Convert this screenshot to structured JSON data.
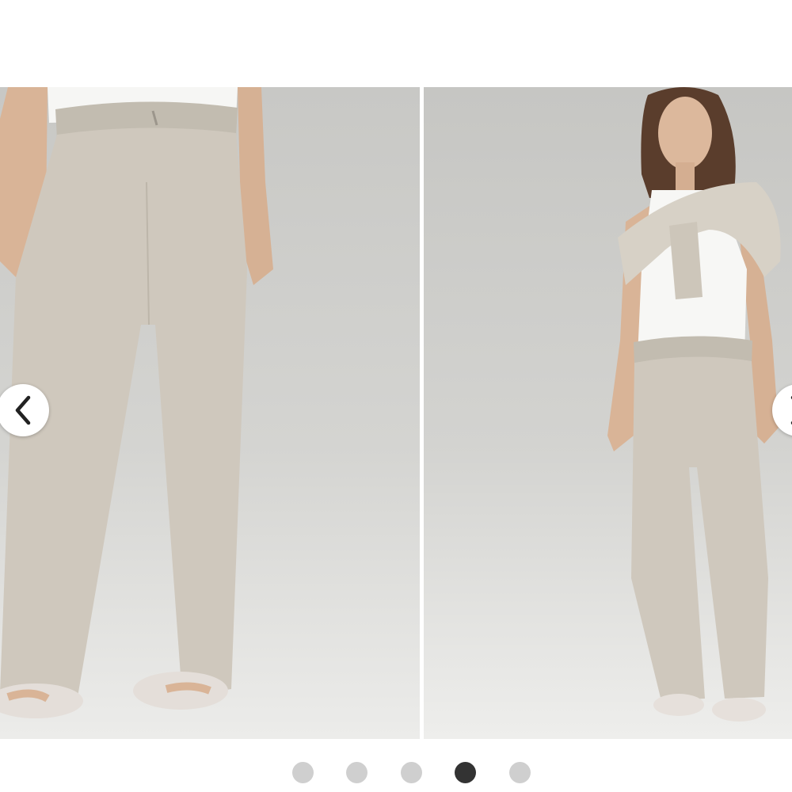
{
  "carousel": {
    "slides": [
      {
        "icon": "product-photo-pants-closeup"
      },
      {
        "icon": "product-photo-model-full-body"
      }
    ],
    "prev_icon": "chevron-left-icon",
    "next_icon": "chevron-right-icon",
    "dots_total": 5,
    "active_dot": 4
  },
  "colors": {
    "background": "#ffffff",
    "studio_bg": "#d2d2cf",
    "pants": "#cfc8bd",
    "dot_inactive": "#cfcfcf",
    "dot_active": "#333333"
  }
}
